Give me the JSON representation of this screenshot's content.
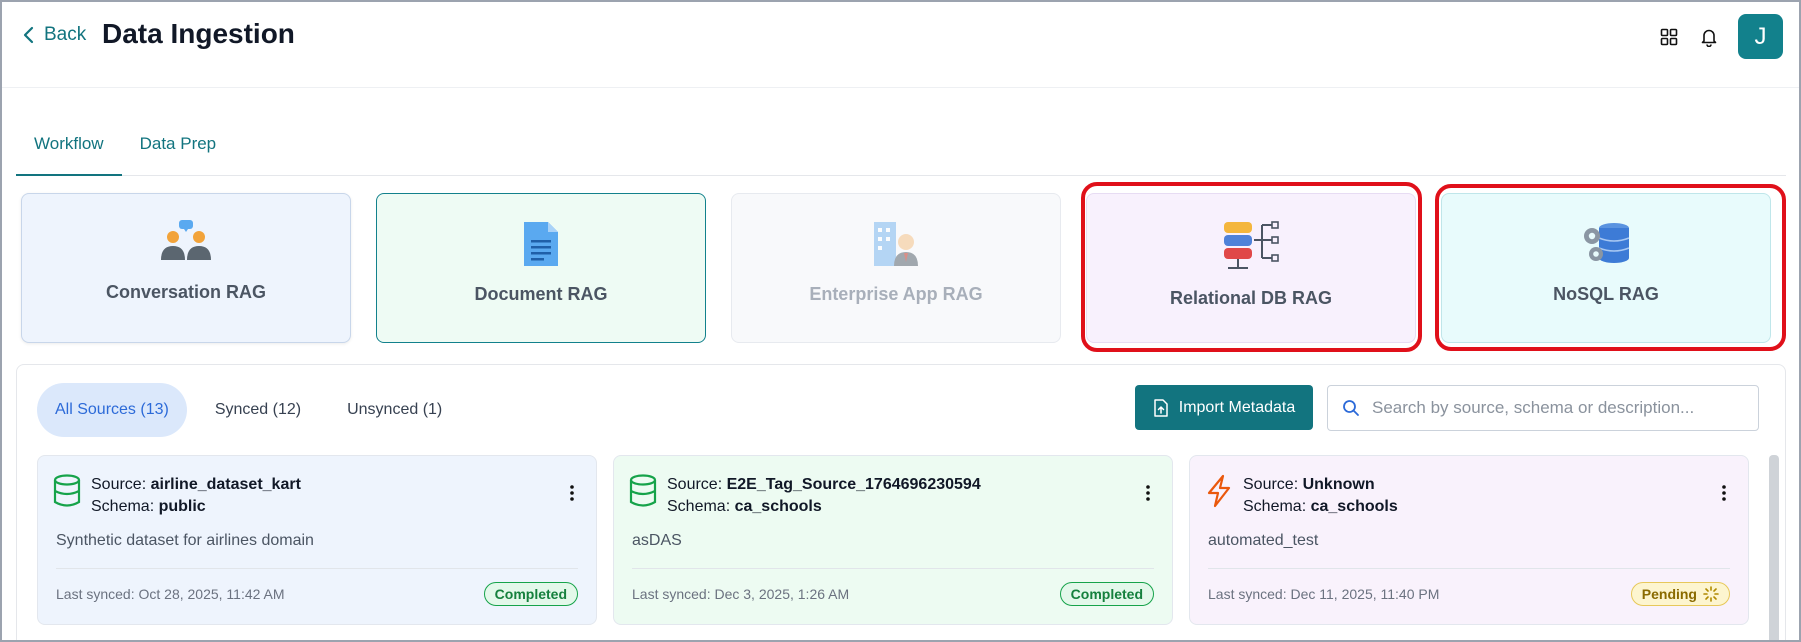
{
  "header": {
    "back_label": "Back",
    "title": "Data Ingestion",
    "avatar_initial": "J"
  },
  "tabs": [
    {
      "label": "Workflow",
      "active": true
    },
    {
      "label": "Data Prep",
      "active": false
    }
  ],
  "rag_cards": [
    {
      "label": "Conversation RAG",
      "icon": "people-chat-icon"
    },
    {
      "label": "Document RAG",
      "icon": "document-icon"
    },
    {
      "label": "Enterprise App RAG",
      "icon": "enterprise-user-icon",
      "disabled": true
    },
    {
      "label": "Relational DB RAG",
      "icon": "relational-db-icon",
      "highlighted": true
    },
    {
      "label": "NoSQL RAG",
      "icon": "nosql-db-gear-icon",
      "highlighted": true
    }
  ],
  "filters": [
    {
      "label": "All Sources (13)",
      "active": true
    },
    {
      "label": "Synced (12)",
      "active": false
    },
    {
      "label": "Unsynced (1)",
      "active": false
    }
  ],
  "import_label": "Import Metadata",
  "search": {
    "placeholder": "Search by source, schema or description..."
  },
  "sources": [
    {
      "source_prefix": "Source: ",
      "source": "airline_dataset_kart",
      "schema_prefix": "Schema: ",
      "schema": "public",
      "description": "Synthetic dataset for airlines domain",
      "last_synced": "Last synced: Oct 28, 2025, 11:42 AM",
      "status": "Completed",
      "icon": "database-icon"
    },
    {
      "source_prefix": "Source: ",
      "source": "E2E_Tag_Source_1764696230594",
      "schema_prefix": "Schema: ",
      "schema": "ca_schools",
      "description": "asDAS",
      "last_synced": "Last synced: Dec 3, 2025, 1:26 AM",
      "status": "Completed",
      "icon": "database-icon"
    },
    {
      "source_prefix": "Source: ",
      "source": "Unknown",
      "schema_prefix": "Schema: ",
      "schema": "ca_schools",
      "description": "automated_test",
      "last_synced": "Last synced: Dec 11, 2025, 11:40 PM",
      "status": "Pending",
      "icon": "lightning-icon"
    }
  ],
  "colors": {
    "accent": "#12747f",
    "highlight": "#e0101a",
    "completed": "#15803d",
    "pending": "#8a6a00"
  }
}
